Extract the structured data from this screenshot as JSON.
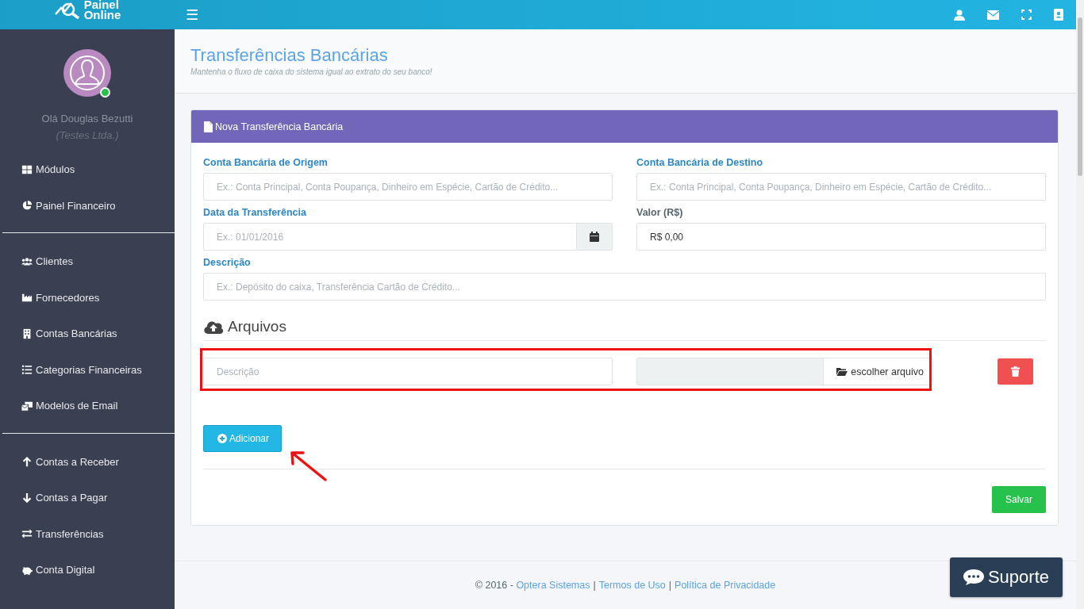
{
  "brand": {
    "line1": "Painel",
    "line2": "Online"
  },
  "menu_icon": "☰",
  "user": {
    "name": "Olá Douglas Bezutti",
    "company": "(Testes Ltda.)",
    "online": true
  },
  "sidebar": {
    "groups": [
      {
        "items": [
          {
            "label": "Módulos"
          },
          {
            "label": "Painel Financeiro"
          }
        ]
      },
      {
        "items": [
          {
            "label": "Clientes"
          },
          {
            "label": "Fornecedores"
          },
          {
            "label": "Contas Bancárias"
          },
          {
            "label": "Categorias Financeiras"
          },
          {
            "label": "Modelos de Email"
          }
        ]
      },
      {
        "items": [
          {
            "label": "Contas a Receber"
          },
          {
            "label": "Contas a Pagar"
          },
          {
            "label": "Transferências"
          },
          {
            "label": "Conta Digital"
          }
        ]
      }
    ]
  },
  "page": {
    "title": "Transferências Bancárias",
    "subtitle": "Mantenha o fluxo de caixa do sistema igual ao extrato do seu banco!"
  },
  "card": {
    "title": "Nova Transferência Bancária",
    "fields": [
      {
        "label": "Conta Bancária de Origem",
        "placeholder": "Ex.: Conta Principal, Conta Poupança, Dinheiro em Espécie, Cartão de Crédito...",
        "kind": "text"
      },
      {
        "label": "Conta Bancária de Destino",
        "placeholder": "Ex.: Conta Principal, Conta Poupança, Dinheiro em Espécie, Cartão de Crédito...",
        "kind": "text"
      },
      {
        "label": "Data da Transferência",
        "placeholder": "Ex.: 01/01/2016",
        "kind": "date"
      },
      {
        "label": "Valor (R$)",
        "value": "R$ 0,00",
        "kind": "text"
      },
      {
        "label": "Descrição",
        "placeholder": "Ex.: Depósito do caixa, Transferência Cartão de Crédito...",
        "kind": "wide"
      }
    ],
    "files_title": "Arquivos",
    "file_row": {
      "placeholder": "Descrição",
      "choose_label": "escolher arquivo"
    },
    "add_label": "Adicionar",
    "save_label": "Salvar"
  },
  "footer": {
    "prefix": "© 2016 -",
    "separator": "|",
    "links": [
      "Optera Sistemas",
      "Termos de Uso",
      "Política de Privacidade"
    ]
  },
  "support_label": "Suporte"
}
